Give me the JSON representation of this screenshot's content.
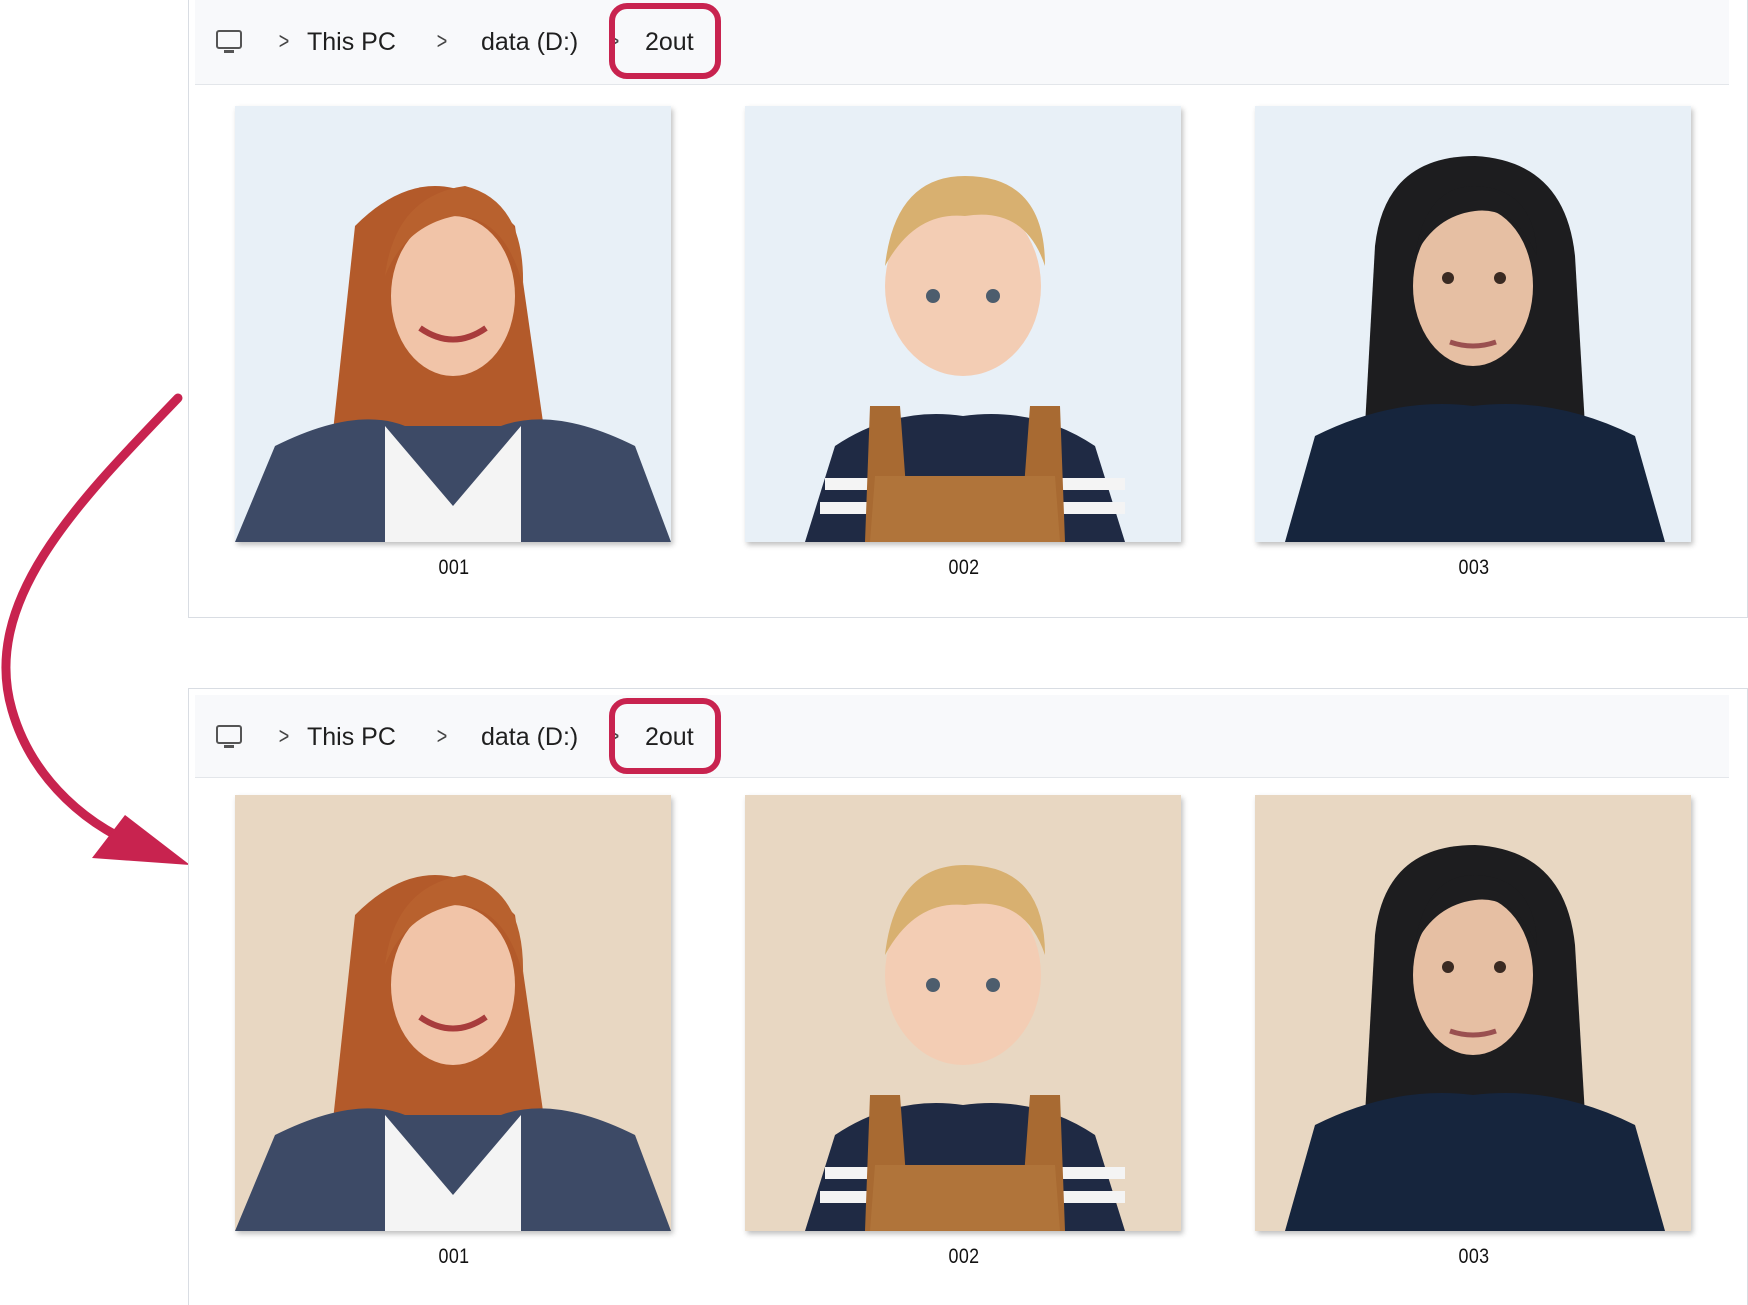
{
  "colors": {
    "highlight": "#c8234f",
    "arrow": "#c8234f",
    "original_background": "#e8f0f7",
    "new_background": "#e8d7c2"
  },
  "top_window": {
    "breadcrumb": {
      "root_icon": "computer-icon",
      "items": [
        "This PC",
        "data (D:)",
        "2out"
      ]
    },
    "files": [
      {
        "name": "001"
      },
      {
        "name": "002"
      },
      {
        "name": "003"
      }
    ]
  },
  "bottom_window": {
    "breadcrumb": {
      "root_icon": "computer-icon",
      "items": [
        "This PC",
        "data (D:)",
        "2out"
      ]
    },
    "files": [
      {
        "name": "001"
      },
      {
        "name": "002"
      },
      {
        "name": "003"
      }
    ]
  }
}
